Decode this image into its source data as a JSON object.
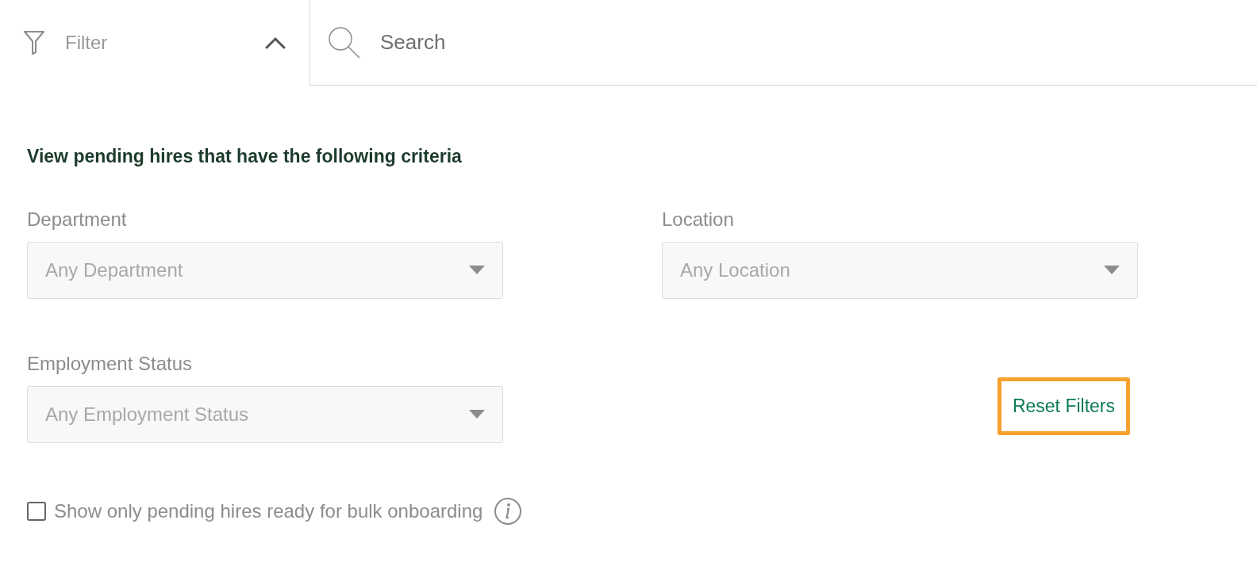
{
  "filter": {
    "label": "Filter",
    "expanded": true
  },
  "search": {
    "placeholder": "Search"
  },
  "criteria": {
    "heading": "View pending hires that have the following criteria",
    "dropdowns": [
      {
        "label": "Department",
        "value": "Any Department"
      },
      {
        "label": "Location",
        "value": "Any Location"
      },
      {
        "label": "Employment Status",
        "value": "Any Employment Status"
      }
    ],
    "reset_button": {
      "label": "Reset Filters",
      "highlighted": true
    },
    "bulk_checkbox": {
      "label": "Show only pending hires ready for bulk onboarding",
      "checked": false
    }
  }
}
